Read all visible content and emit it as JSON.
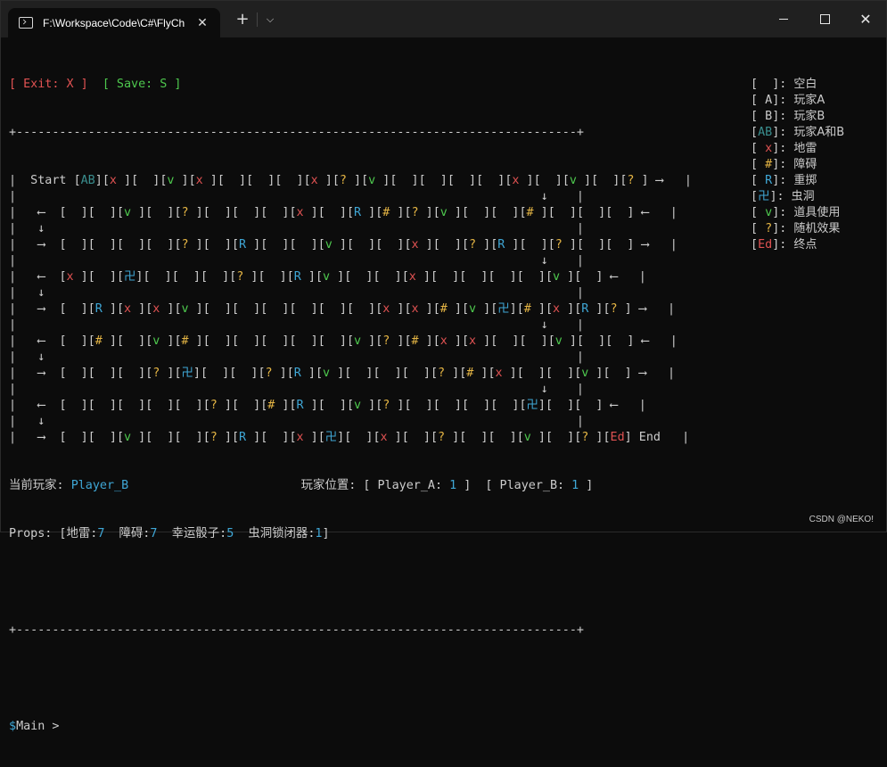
{
  "window": {
    "tab_title": "F:\\Workspace\\Code\\C#\\FlyCh",
    "tab_close": "✕",
    "new_tab": "+",
    "dropdown": "⌵"
  },
  "header_line": {
    "exit": "[ Exit: X ]",
    "save": "[ Save: S ]"
  },
  "border": "+------------------------------------------------------------------------------+",
  "board_rows": [
    {
      "kind": "cells",
      "prefix": "|  Start ",
      "cells": [
        "AB",
        "x",
        " ",
        "v",
        "x",
        " ",
        " ",
        " ",
        "x",
        "?",
        "v",
        " ",
        " ",
        " ",
        " ",
        "x",
        " ",
        "v",
        " ",
        "?"
      ],
      "suffix": " ⟶   |"
    },
    {
      "kind": "text",
      "text": "|                                                                         ↓    |"
    },
    {
      "kind": "cells",
      "prefix": "|   ⟵  ",
      "cells": [
        " ",
        " ",
        "v",
        " ",
        "?",
        " ",
        " ",
        " ",
        "x",
        " ",
        "R",
        "#",
        "?",
        "v",
        " ",
        " ",
        "#",
        " ",
        " ",
        " "
      ],
      "suffix": " ⟵   |"
    },
    {
      "kind": "text",
      "text": "|   ↓                                                                          |"
    },
    {
      "kind": "cells",
      "prefix": "|   ⟶  ",
      "cells": [
        " ",
        " ",
        " ",
        " ",
        "?",
        " ",
        "R",
        " ",
        " ",
        "v",
        " ",
        " ",
        "x",
        " ",
        "?",
        "R",
        " ",
        "?",
        " ",
        " "
      ],
      "suffix": " ⟶   |"
    },
    {
      "kind": "text",
      "text": "|                                                                         ↓    |"
    },
    {
      "kind": "cells",
      "prefix": "|   ⟵  ",
      "cells": [
        "x",
        " ",
        "卍",
        " ",
        " ",
        " ",
        "?",
        " ",
        "R",
        "v",
        " ",
        " ",
        "x",
        " ",
        " ",
        " ",
        " ",
        "v",
        " "
      ],
      "suffix": " ⟵   |"
    },
    {
      "kind": "text",
      "text": "|   ↓                                                                          |"
    },
    {
      "kind": "cells",
      "prefix": "|   ⟶  ",
      "cells": [
        " ",
        "R",
        "x",
        "x",
        "v",
        " ",
        " ",
        " ",
        " ",
        " ",
        " ",
        "x",
        "x",
        "#",
        "v",
        "卍",
        "#",
        "x",
        "R",
        "?"
      ],
      "suffix": " ⟶   |"
    },
    {
      "kind": "text",
      "text": "|                                                                         ↓    |"
    },
    {
      "kind": "cells",
      "prefix": "|   ⟵  ",
      "cells": [
        " ",
        "#",
        " ",
        "v",
        "#",
        " ",
        " ",
        " ",
        " ",
        " ",
        "v",
        "?",
        "#",
        "x",
        "x",
        " ",
        " ",
        "v",
        " ",
        " "
      ],
      "suffix": " ⟵   |"
    },
    {
      "kind": "text",
      "text": "|   ↓                                                                          |"
    },
    {
      "kind": "cells",
      "prefix": "|   ⟶  ",
      "cells": [
        " ",
        " ",
        " ",
        "?",
        "卍",
        " ",
        " ",
        "?",
        "R",
        "v",
        " ",
        " ",
        " ",
        "?",
        "#",
        "x",
        " ",
        " ",
        "v",
        " "
      ],
      "suffix": " ⟶   |"
    },
    {
      "kind": "text",
      "text": "|                                                                         ↓    |"
    },
    {
      "kind": "cells",
      "prefix": "|   ⟵  ",
      "cells": [
        " ",
        " ",
        " ",
        " ",
        " ",
        "?",
        " ",
        "#",
        "R",
        " ",
        "v",
        "?",
        " ",
        " ",
        " ",
        " ",
        "卍",
        " ",
        " "
      ],
      "suffix": " ⟵   |"
    },
    {
      "kind": "text",
      "text": "|   ↓                                                                          |"
    },
    {
      "kind": "cells",
      "prefix": "|   ⟶  ",
      "cells": [
        " ",
        " ",
        "v",
        " ",
        " ",
        "?",
        "R",
        " ",
        "x",
        "卍",
        " ",
        "x",
        " ",
        "?",
        " ",
        " ",
        "v",
        " ",
        "?",
        "Ed"
      ],
      "suffix": " End   |"
    }
  ],
  "status": {
    "current_label": "当前玩家: ",
    "current_player": "Player_B",
    "position_label": "玩家位置: [ Player_A: ",
    "pos_a": "1",
    "pos_mid": " ]  [ Player_B: ",
    "pos_b": "1",
    "pos_end": " ]"
  },
  "props": {
    "label": "Props: [",
    "items": [
      {
        "name": "地雷",
        "count": "7"
      },
      {
        "name": "障碍",
        "count": "7"
      },
      {
        "name": "幸运骰子",
        "count": "5"
      },
      {
        "name": "虫洞锁闭器",
        "count": "1"
      }
    ],
    "end": "]"
  },
  "prompt": {
    "sign": "$",
    "text": "Main > "
  },
  "legend": [
    {
      "symbol": " ",
      "label": "空白"
    },
    {
      "symbol": "A",
      "label": "玩家A"
    },
    {
      "symbol": "B",
      "label": "玩家B"
    },
    {
      "symbol": "AB",
      "label": "玩家A和B"
    },
    {
      "symbol": "x",
      "label": "地雷"
    },
    {
      "symbol": "#",
      "label": "障碍"
    },
    {
      "symbol": "R",
      "label": "重掷"
    },
    {
      "symbol": "卍",
      "label": "虫洞"
    },
    {
      "symbol": "v",
      "label": "道具使用"
    },
    {
      "symbol": "?",
      "label": "随机效果"
    },
    {
      "symbol": "Ed",
      "label": "终点"
    }
  ],
  "watermark": "CSDN @NEKO!",
  "colors": {
    "mine": "#e05252",
    "obstacle": "#e5b544",
    "reroll": "#3fa7d6",
    "prop": "#4ec94e",
    "player": "#3fa7d6"
  }
}
